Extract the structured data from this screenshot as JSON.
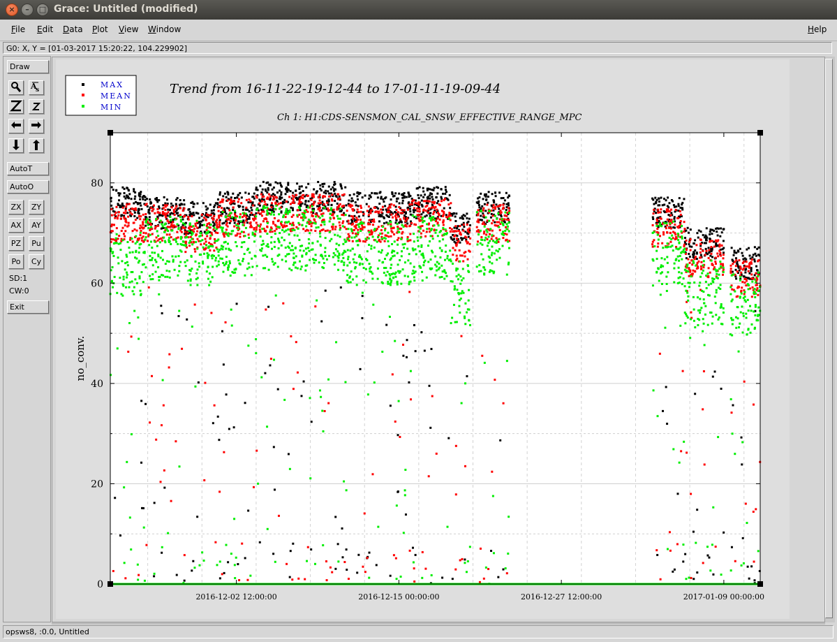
{
  "window": {
    "title": "Grace: Untitled (modified)"
  },
  "menubar": {
    "items": [
      "File",
      "Edit",
      "Data",
      "Plot",
      "View",
      "Window"
    ],
    "help": "Help"
  },
  "locator": {
    "text": "G0: X, Y = [01-03-2017 15:20:22, 104.229902]"
  },
  "toolbar": {
    "draw": "Draw",
    "zoom_icon": "magnifier-icon",
    "autot": "AutoT",
    "autoo": "AutoO",
    "zx": "ZX",
    "zy": "ZY",
    "ax": "AX",
    "ay": "AY",
    "pz": "PZ",
    "pu": "Pu",
    "po": "Po",
    "cy": "Cy",
    "sd": "SD:1",
    "cw": "CW:0",
    "exit": "Exit"
  },
  "status": {
    "text": "opsws8, :0.0, Untitled"
  },
  "chart_data": {
    "type": "scatter",
    "title": "Trend from 16-11-22-19-12-44 to 17-01-11-19-09-44",
    "subtitle": "Ch 1: H1:CDS-SENSMON_CAL_SNSW_EFFECTIVE_RANGE_MPC",
    "ylabel": "no_conv.",
    "xlabel": "",
    "ylim": [
      0,
      90
    ],
    "ytick_labels": [
      "0",
      "20",
      "40",
      "60",
      "80"
    ],
    "xtick_labels": [
      "2016-12-02 12:00:00",
      "2016-12-15 00:00:00",
      "2016-12-27 12:00:00",
      "2017-01-09 00:00:00"
    ],
    "xlim": [
      "2016-11-22 19:12:44",
      "2017-01-11 19:09:44"
    ],
    "grid": true,
    "legend_placement": "top-left, outside plot",
    "series": [
      {
        "name": "MAX",
        "color": "#000000",
        "segments": [
          {
            "x_start": "2016-11-22 19:12",
            "x_end": "2016-11-25 12:00",
            "y": 76
          },
          {
            "x_start": "2016-11-25 12:00",
            "x_end": "2016-11-28 12:00",
            "y": 74
          },
          {
            "x_start": "2016-11-28 12:00",
            "x_end": "2016-12-01 00:00",
            "y": 73
          },
          {
            "x_start": "2016-12-01 00:00",
            "x_end": "2016-12-04 00:00",
            "y": 75
          },
          {
            "x_start": "2016-12-04 00:00",
            "x_end": "2016-12-07 00:00",
            "y": 77
          },
          {
            "x_start": "2016-12-07 00:00",
            "x_end": "2016-12-11 00:00",
            "y": 77
          },
          {
            "x_start": "2016-12-11 00:00",
            "x_end": "2016-12-16 00:00",
            "y": 75
          },
          {
            "x_start": "2016-12-16 00:00",
            "x_end": "2016-12-19 00:00",
            "y": 76
          },
          {
            "x_start": "2016-12-19 00:00",
            "x_end": "2016-12-20 12:00",
            "y": 71
          },
          {
            "x_start": "2016-12-21 00:00",
            "x_end": "2016-12-23 12:00",
            "y": 75
          },
          {
            "x_start": "2017-01-03 12:00",
            "x_end": "2017-01-06 00:00",
            "y": 74
          },
          {
            "x_start": "2017-01-06 00:00",
            "x_end": "2017-01-09 00:00",
            "y": 68
          },
          {
            "x_start": "2017-01-09 12:00",
            "x_end": "2017-01-11 19:09",
            "y": 64
          }
        ]
      },
      {
        "name": "MEAN",
        "color": "#ff0000",
        "segments": [
          {
            "x_start": "2016-11-22 19:12",
            "x_end": "2016-11-25 12:00",
            "y": 72
          },
          {
            "x_start": "2016-11-25 12:00",
            "x_end": "2016-11-28 12:00",
            "y": 72
          },
          {
            "x_start": "2016-11-28 12:00",
            "x_end": "2016-12-01 00:00",
            "y": 70
          },
          {
            "x_start": "2016-12-01 00:00",
            "x_end": "2016-12-04 00:00",
            "y": 73
          },
          {
            "x_start": "2016-12-04 00:00",
            "x_end": "2016-12-07 00:00",
            "y": 74
          },
          {
            "x_start": "2016-12-07 00:00",
            "x_end": "2016-12-11 00:00",
            "y": 74
          },
          {
            "x_start": "2016-12-11 00:00",
            "x_end": "2016-12-16 00:00",
            "y": 72
          },
          {
            "x_start": "2016-12-16 00:00",
            "x_end": "2016-12-19 00:00",
            "y": 73
          },
          {
            "x_start": "2016-12-19 00:00",
            "x_end": "2016-12-20 12:00",
            "y": 68
          },
          {
            "x_start": "2016-12-21 00:00",
            "x_end": "2016-12-23 12:00",
            "y": 72
          },
          {
            "x_start": "2017-01-03 12:00",
            "x_end": "2017-01-06 00:00",
            "y": 71
          },
          {
            "x_start": "2017-01-06 00:00",
            "x_end": "2017-01-09 00:00",
            "y": 65
          },
          {
            "x_start": "2017-01-09 12:00",
            "x_end": "2017-01-11 19:09",
            "y": 61
          }
        ]
      },
      {
        "name": "MIN",
        "color": "#00ff00",
        "segments": [
          {
            "x_start": "2016-11-22 19:12",
            "x_end": "2016-11-25 12:00",
            "y": 64
          },
          {
            "x_start": "2016-11-25 12:00",
            "x_end": "2016-11-28 12:00",
            "y": 67
          },
          {
            "x_start": "2016-11-28 12:00",
            "x_end": "2016-12-01 00:00",
            "y": 66
          },
          {
            "x_start": "2016-12-01 00:00",
            "x_end": "2016-12-04 00:00",
            "y": 68
          },
          {
            "x_start": "2016-12-04 00:00",
            "x_end": "2016-12-07 00:00",
            "y": 69
          },
          {
            "x_start": "2016-12-07 00:00",
            "x_end": "2016-12-11 00:00",
            "y": 69
          },
          {
            "x_start": "2016-12-11 00:00",
            "x_end": "2016-12-16 00:00",
            "y": 66
          },
          {
            "x_start": "2016-12-16 00:00",
            "x_end": "2016-12-19 00:00",
            "y": 67
          },
          {
            "x_start": "2016-12-19 00:00",
            "x_end": "2016-12-20 12:00",
            "y": 58
          },
          {
            "x_start": "2016-12-21 00:00",
            "x_end": "2016-12-23 12:00",
            "y": 68
          },
          {
            "x_start": "2017-01-03 12:00",
            "x_end": "2017-01-06 00:00",
            "y": 66
          },
          {
            "x_start": "2017-01-06 00:00",
            "x_end": "2017-01-09 00:00",
            "y": 58
          },
          {
            "x_start": "2017-01-09 12:00",
            "x_end": "2017-01-11 19:09",
            "y": 56
          }
        ],
        "baseline_value": 0
      }
    ]
  }
}
